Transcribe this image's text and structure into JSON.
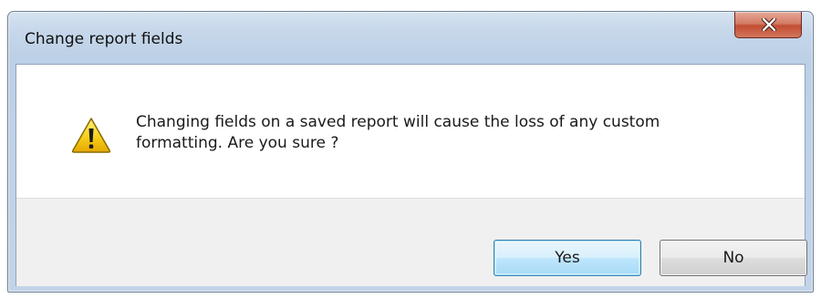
{
  "dialog": {
    "title": "Change report fields",
    "message_line1": "Changing fields on a saved report will cause the loss of any custom",
    "message_line2": "formatting. Are you sure ?",
    "icon": "warning-icon",
    "close_icon": "close-icon",
    "buttons": {
      "yes_label": "Yes",
      "no_label": "No"
    }
  },
  "colors": {
    "titlebar": "#c6d7ea",
    "close_button": "#c24d33",
    "default_button_border": "#3c7fb1",
    "warning_yellow": "#f5c400"
  }
}
